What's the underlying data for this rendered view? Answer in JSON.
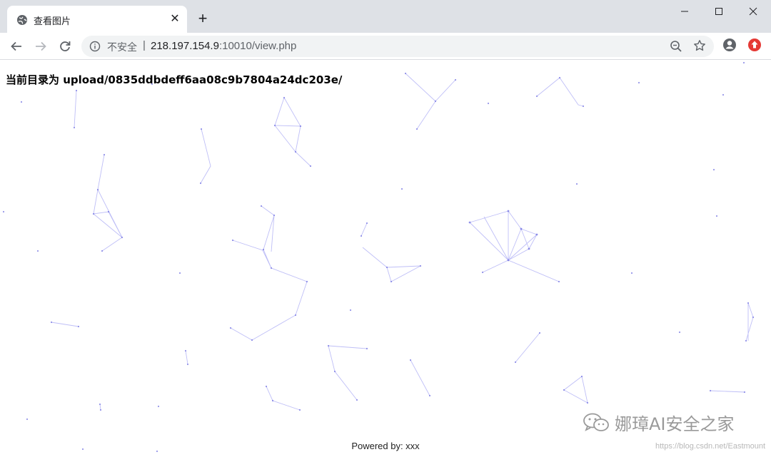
{
  "browser": {
    "tab_title": "查看图片",
    "tab_close_glyph": "✕",
    "newtab_glyph": "+",
    "security_label": "不安全",
    "separator": "|",
    "url_host": "218.197.154.9",
    "url_rest": ":10010/view.php",
    "icons": [
      "globe-icon",
      "back-icon",
      "forward-icon",
      "reload-icon",
      "info-icon",
      "zoom-icon",
      "star-icon",
      "account-icon",
      "extension-icon",
      "minimize-icon",
      "maximize-icon",
      "close-icon"
    ]
  },
  "page": {
    "heading": "当前目录为 upload/0835ddbdeff6aa08c9b7804a24dc203e/",
    "footer": "Powered by: xxx"
  },
  "watermark": {
    "brand": "娜璋AI安全之家",
    "url": "https://blog.csdn.net/Eastmount"
  },
  "colors": {
    "particle_line": "#8a8af0",
    "particle_dot": "#6a6ae0",
    "tabstrip": "#dee1e6",
    "omnibox": "#f1f3f4"
  }
}
